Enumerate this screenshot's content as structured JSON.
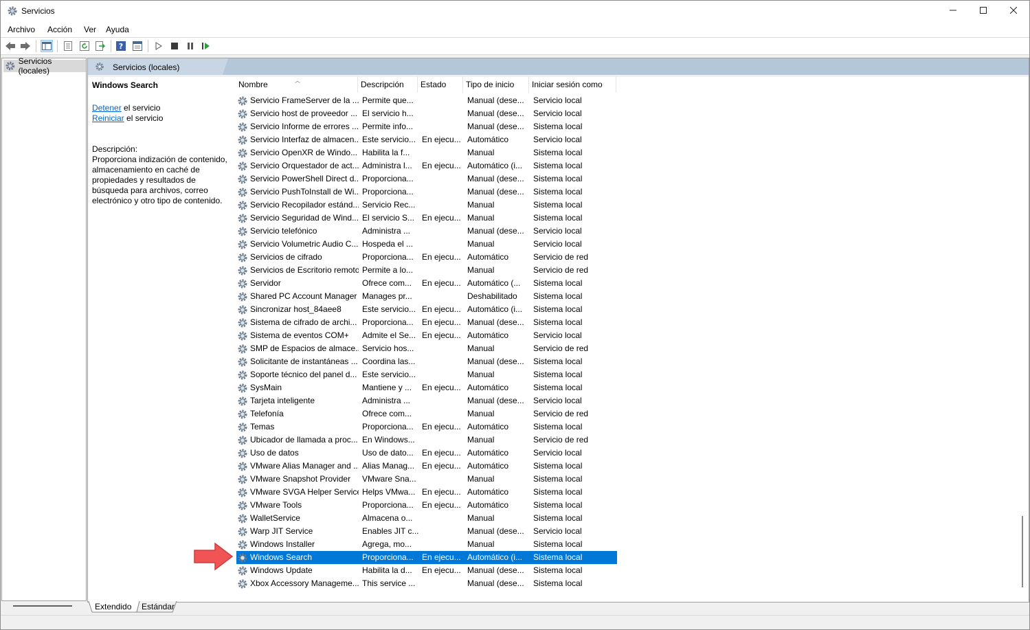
{
  "window": {
    "title": "Servicios",
    "minimize_icon": "minimize-icon",
    "maximize_icon": "maximize-icon",
    "close_icon": "close-icon"
  },
  "menu": {
    "items": [
      "Archivo",
      "Acción",
      "Ver",
      "Ayuda"
    ]
  },
  "toolbar": {
    "icons": [
      "back-icon",
      "forward-icon",
      "show-tree-icon",
      "properties-icon",
      "refresh-icon",
      "export-icon",
      "help-icon",
      "view-icon",
      "start-icon",
      "stop-icon",
      "pause-icon",
      "restart-icon"
    ]
  },
  "tree": {
    "item_label": "Servicios (locales)"
  },
  "pane": {
    "title": "Servicios (locales)"
  },
  "details": {
    "service_name": "Windows Search",
    "stop_link": "Detener",
    "stop_suffix": " el servicio",
    "restart_link": "Reiniciar",
    "restart_suffix": " el servicio",
    "description_label": "Descripción:",
    "description_text": "Proporciona indización de contenido, almacenamiento en caché de propiedades y resultados de búsqueda para archivos, correo electrónico y otro tipo de contenido."
  },
  "columns": [
    "Nombre",
    "Descripción",
    "Estado",
    "Tipo de inicio",
    "Iniciar sesión como"
  ],
  "rows": [
    [
      "Servicio FrameServer de la ...",
      "Permite que...",
      "",
      "Manual (dese...",
      "Servicio local"
    ],
    [
      "Servicio host de proveedor ...",
      "El servicio h...",
      "",
      "Manual (dese...",
      "Servicio local"
    ],
    [
      "Servicio Informe de errores ...",
      "Permite info...",
      "",
      "Manual (dese...",
      "Sistema local"
    ],
    [
      "Servicio Interfaz de almacen...",
      "Este servicio...",
      "En ejecu...",
      "Automático",
      "Servicio local"
    ],
    [
      "Servicio OpenXR de Windo...",
      "Habilita la f...",
      "",
      "Manual",
      "Sistema local"
    ],
    [
      "Servicio Orquestador de act...",
      "Administra l...",
      "En ejecu...",
      "Automático (i...",
      "Sistema local"
    ],
    [
      "Servicio PowerShell Direct d...",
      "Proporciona...",
      "",
      "Manual (dese...",
      "Sistema local"
    ],
    [
      "Servicio PushToInstall de Wi...",
      "Proporciona...",
      "",
      "Manual (dese...",
      "Sistema local"
    ],
    [
      "Servicio Recopilador estánd...",
      "Servicio Rec...",
      "",
      "Manual",
      "Sistema local"
    ],
    [
      "Servicio Seguridad de Wind...",
      "El servicio S...",
      "En ejecu...",
      "Manual",
      "Sistema local"
    ],
    [
      "Servicio telefónico",
      "Administra ...",
      "",
      "Manual (dese...",
      "Servicio local"
    ],
    [
      "Servicio Volumetric Audio C...",
      "Hospeda el ...",
      "",
      "Manual",
      "Servicio local"
    ],
    [
      "Servicios de cifrado",
      "Proporciona...",
      "En ejecu...",
      "Automático",
      "Servicio de red"
    ],
    [
      "Servicios de Escritorio remoto",
      "Permite a lo...",
      "",
      "Manual",
      "Servicio de red"
    ],
    [
      "Servidor",
      "Ofrece com...",
      "En ejecu...",
      "Automático (...",
      "Sistema local"
    ],
    [
      "Shared PC Account Manager",
      "Manages pr...",
      "",
      "Deshabilitado",
      "Sistema local"
    ],
    [
      "Sincronizar host_84aee8",
      "Este servicio...",
      "En ejecu...",
      "Automático (i...",
      "Sistema local"
    ],
    [
      "Sistema de cifrado de archi...",
      "Proporciona...",
      "En ejecu...",
      "Manual (dese...",
      "Sistema local"
    ],
    [
      "Sistema de eventos COM+",
      "Admite el Se...",
      "En ejecu...",
      "Automático",
      "Servicio local"
    ],
    [
      "SMP de Espacios de almace...",
      "Servicio hos...",
      "",
      "Manual",
      "Servicio de red"
    ],
    [
      "Solicitante de instantáneas ...",
      "Coordina las...",
      "",
      "Manual (dese...",
      "Sistema local"
    ],
    [
      "Soporte técnico del panel d...",
      "Este servicio...",
      "",
      "Manual",
      "Sistema local"
    ],
    [
      "SysMain",
      "Mantiene y ...",
      "En ejecu...",
      "Automático",
      "Sistema local"
    ],
    [
      "Tarjeta inteligente",
      "Administra ...",
      "",
      "Manual (dese...",
      "Servicio local"
    ],
    [
      "Telefonía",
      "Ofrece com...",
      "",
      "Manual",
      "Servicio de red"
    ],
    [
      "Temas",
      "Proporciona...",
      "En ejecu...",
      "Automático",
      "Sistema local"
    ],
    [
      "Ubicador de llamada a proc...",
      "En Windows...",
      "",
      "Manual",
      "Servicio de red"
    ],
    [
      "Uso de datos",
      "Uso de dato...",
      "En ejecu...",
      "Automático",
      "Servicio local"
    ],
    [
      "VMware Alias Manager and ...",
      "Alias Manag...",
      "En ejecu...",
      "Automático",
      "Sistema local"
    ],
    [
      "VMware Snapshot Provider",
      "VMware Sna...",
      "",
      "Manual",
      "Sistema local"
    ],
    [
      "VMware SVGA Helper Service",
      "Helps VMwa...",
      "En ejecu...",
      "Automático",
      "Sistema local"
    ],
    [
      "VMware Tools",
      "Proporciona...",
      "En ejecu...",
      "Automático",
      "Sistema local"
    ],
    [
      "WalletService",
      "Almacena o...",
      "",
      "Manual",
      "Sistema local"
    ],
    [
      "Warp JIT Service",
      "Enables JIT c...",
      "",
      "Manual (dese...",
      "Servicio local"
    ],
    [
      "Windows Installer",
      "Agrega, mo...",
      "",
      "Manual",
      "Sistema local"
    ],
    [
      "Windows Search",
      "Proporciona...",
      "En ejecu...",
      "Automático (i...",
      "Sistema local"
    ],
    [
      "Windows Update",
      "Habilita la d...",
      "En ejecu...",
      "Manual (dese...",
      "Sistema local"
    ],
    [
      "Xbox Accessory Manageme...",
      "This service ...",
      "",
      "Manual (dese...",
      "Sistema local"
    ]
  ],
  "selected_row": 35,
  "tabs": [
    "Extendido",
    "Estándar"
  ],
  "colors": {
    "selection": "#0078d7",
    "link": "#0066cc",
    "arrow": "#f05454",
    "header_band": "#b3c7d9"
  }
}
